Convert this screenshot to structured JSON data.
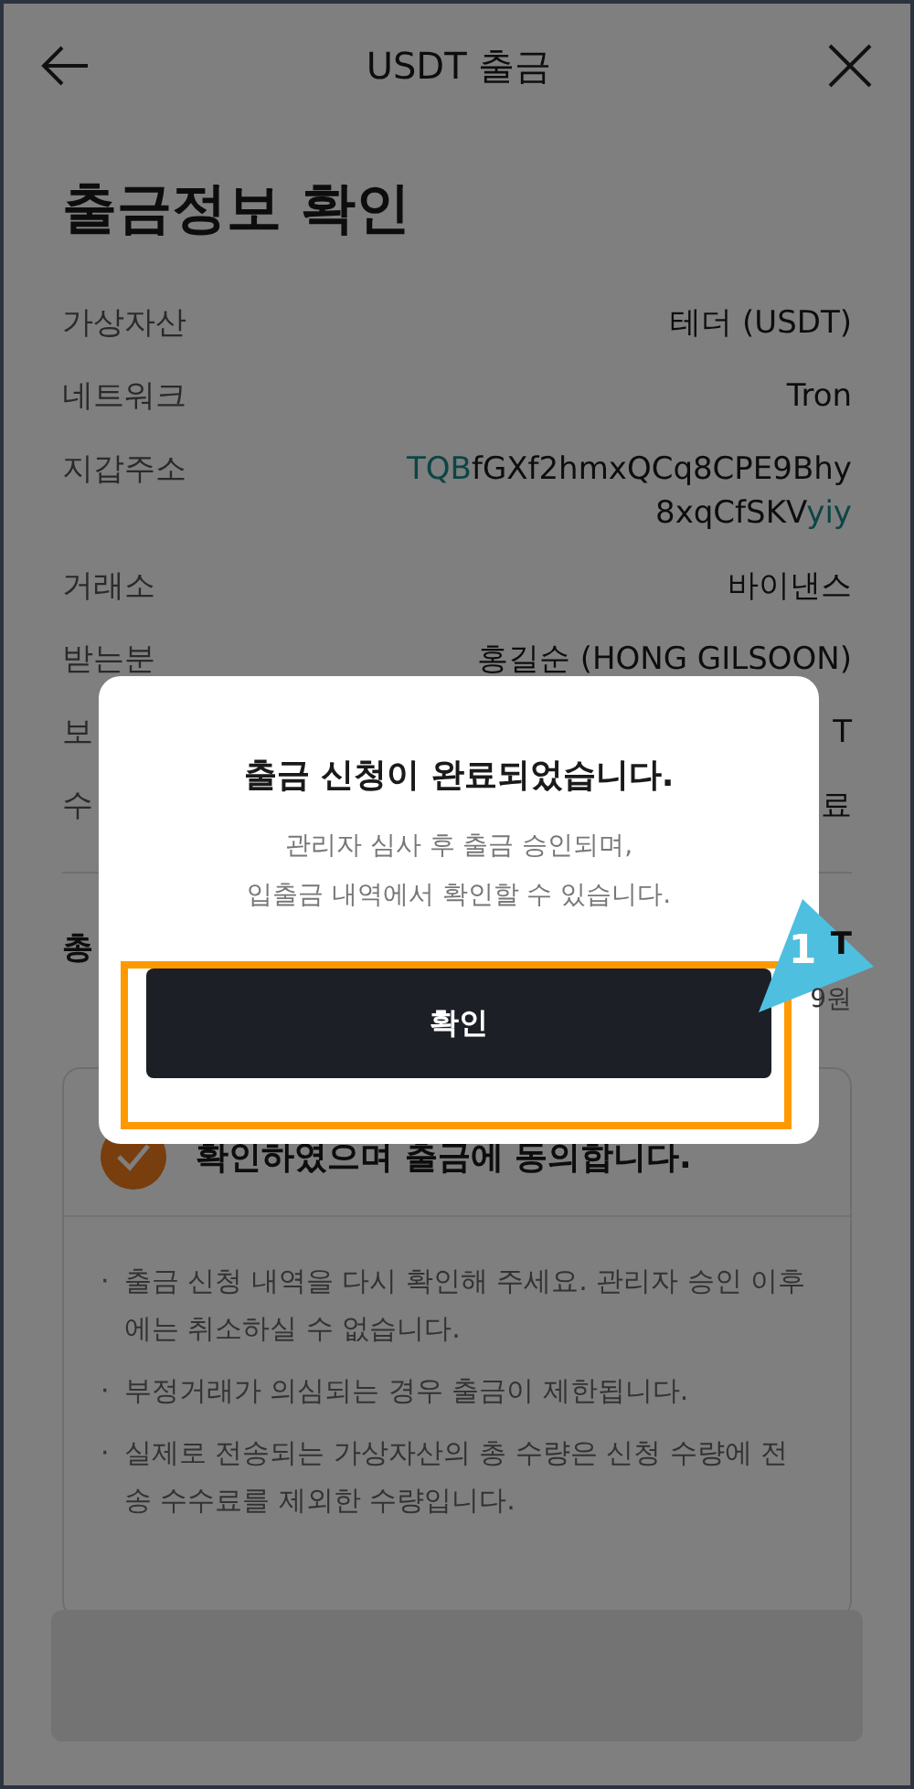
{
  "header": {
    "title": "USDT 출금"
  },
  "page_title": "출금정보 확인",
  "details": [
    {
      "label": "가상자산",
      "value": [
        {
          "text": "테더 (USDT)",
          "highlight": false
        }
      ]
    },
    {
      "label": "네트워크",
      "value": [
        {
          "text": "Tron",
          "highlight": false
        }
      ]
    },
    {
      "label": "지갑주소",
      "value": [
        {
          "text": "TQB",
          "highlight": true
        },
        {
          "text": "fGXf2hmxQCq8CPE9Bhy8xqCfSKV",
          "highlight": false
        },
        {
          "text": "yiy",
          "highlight": true
        }
      ]
    },
    {
      "label": "거래소",
      "value": [
        {
          "text": "바이낸스",
          "highlight": false
        }
      ]
    },
    {
      "label": "받는분",
      "value": [
        {
          "text": "홍길순 (HONG GILSOON)",
          "highlight": false
        }
      ]
    },
    {
      "label": "보",
      "value": [
        {
          "text": "T",
          "highlight": false
        }
      ]
    },
    {
      "label": "수",
      "value": [
        {
          "text": "료",
          "highlight": false
        }
      ]
    }
  ],
  "total": {
    "label": "총",
    "value": "T",
    "sub_value": "9원"
  },
  "agreement": {
    "label": "확인하였으며 출금에 동의합니다.",
    "checked": true
  },
  "notes": {
    "bullet": "·",
    "items": [
      "출금 신청 내역을 다시 확인해 주세요. 관리자 승인 이후에는 취소하실 수 없습니다.",
      "부정거래가 의심되는 경우 출금이 제한됩니다.",
      "실제로 전송되는 가상자산의 총 수량은 신청 수량에 전송 수수료를 제외한 수량입니다."
    ]
  },
  "dialog": {
    "title": "출금 신청이 완료되었습니다.",
    "message": [
      "관리자 심사 후 출금 승인되며,",
      "입출금 내역에서 확인할 수 있습니다."
    ],
    "button": "확인"
  },
  "annotation": {
    "number": "1"
  }
}
